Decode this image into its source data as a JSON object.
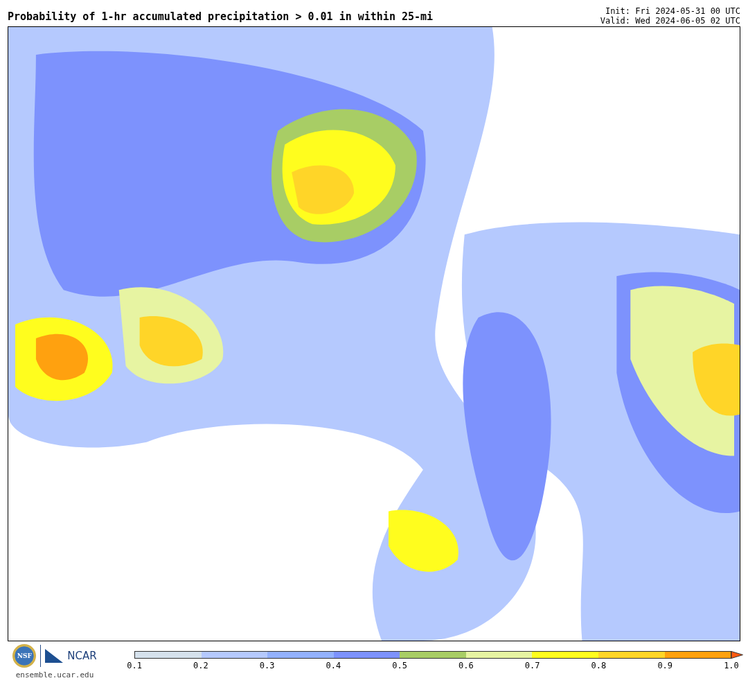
{
  "title": "Probability of 1-hr accumulated precipitation > 0.01 in within 25-mi",
  "init": "Init: Fri 2024-05-31 00 UTC",
  "valid": "Valid: Wed 2024-06-05 02 UTC",
  "logos": {
    "nsf": "NSF",
    "ncar": "NCAR"
  },
  "url": "ensemble.ucar.edu",
  "colorbar": {
    "bins": [
      {
        "color": "#d5e1ec"
      },
      {
        "color": "#b5c9fe"
      },
      {
        "color": "#93b1fe"
      },
      {
        "color": "#7d92fd"
      },
      {
        "color": "#a8cd65"
      },
      {
        "color": "#e7f4a2"
      },
      {
        "color": "#fffd1e"
      },
      {
        "color": "#ffd528"
      },
      {
        "color": "#ffa10f"
      }
    ],
    "extend_arrow": {
      "color": "#ff5a10"
    },
    "ticks": [
      "0.1",
      "0.2",
      "0.3",
      "0.4",
      "0.5",
      "0.6",
      "0.7",
      "0.8",
      "0.9",
      "1.0"
    ]
  }
}
